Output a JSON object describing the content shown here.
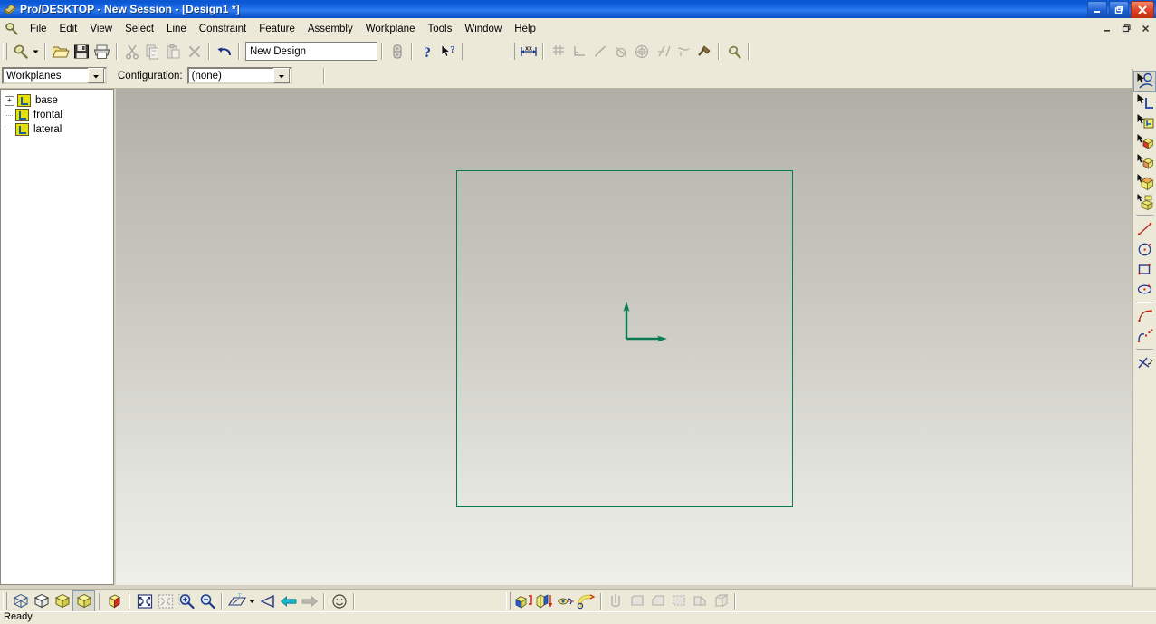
{
  "window": {
    "title": "Pro/DESKTOP - New Session - [Design1 *]",
    "app_icon": "pro-desktop-icon",
    "minimize_label": "–",
    "maximize_label": "❐",
    "close_label": "✕",
    "mdi_minimize_label": "–",
    "mdi_restore_label": "❐",
    "mdi_close_label": "✕"
  },
  "menubar": {
    "system_icon": "document-icon",
    "items": [
      {
        "label": "File"
      },
      {
        "label": "Edit"
      },
      {
        "label": "View"
      },
      {
        "label": "Select"
      },
      {
        "label": "Line"
      },
      {
        "label": "Constraint"
      },
      {
        "label": "Feature"
      },
      {
        "label": "Assembly"
      },
      {
        "label": "Workplane"
      },
      {
        "label": "Tools"
      },
      {
        "label": "Window"
      },
      {
        "label": "Help"
      }
    ]
  },
  "toolbar_main": {
    "design_name_value": "New Design",
    "buttons": [
      {
        "name": "select-tool-button",
        "icon": "magnifier-lasso-icon",
        "enabled": true
      },
      {
        "name": "select-tool-dropdown",
        "icon": "chevron-down-icon",
        "enabled": true
      },
      {
        "name": "open-button",
        "icon": "open-folder-icon",
        "enabled": true
      },
      {
        "name": "save-button",
        "icon": "floppy-save-icon",
        "enabled": true
      },
      {
        "name": "print-button",
        "icon": "printer-icon",
        "enabled": true
      },
      {
        "name": "cut-button",
        "icon": "scissors-icon",
        "enabled": false
      },
      {
        "name": "copy-button",
        "icon": "copy-icon",
        "enabled": false
      },
      {
        "name": "paste-button",
        "icon": "clipboard-paste-icon",
        "enabled": false
      },
      {
        "name": "delete-button",
        "icon": "x-delete-icon",
        "enabled": false
      },
      {
        "name": "undo-button",
        "icon": "undo-arrow-icon",
        "enabled": true
      },
      {
        "name": "browser-button",
        "icon": "browser-icon",
        "enabled": true
      },
      {
        "name": "help-button",
        "icon": "question-mark-icon",
        "enabled": true
      },
      {
        "name": "context-help-button",
        "icon": "arrow-question-icon",
        "enabled": true
      },
      {
        "name": "dimension-button",
        "icon": "dimension-xx-icon",
        "enabled": true
      },
      {
        "name": "constraint-coincident-button",
        "icon": "coincident-icon",
        "enabled": false
      },
      {
        "name": "constraint-perpendicular-button",
        "icon": "perpendicular-icon",
        "enabled": false
      },
      {
        "name": "constraint-parallel-button",
        "icon": "parallel-line-icon",
        "enabled": false
      },
      {
        "name": "constraint-tangent-button",
        "icon": "tangent-icon",
        "enabled": false
      },
      {
        "name": "constraint-concentric-button",
        "icon": "concentric-circle-icon",
        "enabled": false
      },
      {
        "name": "constraint-equal-button",
        "icon": "equal-length-icon",
        "enabled": false
      },
      {
        "name": "constraint-symmetry-button",
        "icon": "symmetry-icon",
        "enabled": false
      },
      {
        "name": "constraint-fix-button",
        "icon": "anchor-fix-icon",
        "enabled": false
      },
      {
        "name": "inspect-button",
        "icon": "magnifier-icon",
        "enabled": true
      }
    ]
  },
  "toolbar_secondary": {
    "workplanes_select_value": "Workplanes",
    "configuration_label": "Configuration:",
    "configuration_select_value": "(none)"
  },
  "tree": {
    "items": [
      {
        "label": "base",
        "icon": "workplane-icon",
        "expander": "+",
        "has_expander": true
      },
      {
        "label": "frontal",
        "icon": "workplane-icon",
        "expander": "",
        "has_expander": false
      },
      {
        "label": "lateral",
        "icon": "workplane-icon",
        "expander": "",
        "has_expander": false
      }
    ]
  },
  "canvas": {
    "name": "design-viewport",
    "workplane_outline_color": "#0a7a52",
    "origin_axes_color": "#0a7a52",
    "background_top_color": "#aeaea4",
    "background_bottom_color": "#efefe9"
  },
  "toolbar_right": {
    "buttons": [
      {
        "name": "select-edges-button",
        "icon": "select-lasso-icon"
      },
      {
        "name": "select-lines-button",
        "icon": "select-corner-icon"
      },
      {
        "name": "select-workplane-button",
        "icon": "select-workplane-icon"
      },
      {
        "name": "select-face-button",
        "icon": "select-face-cube-icon"
      },
      {
        "name": "select-feature-button",
        "icon": "select-feature-cube-icon"
      },
      {
        "name": "select-part-button",
        "icon": "select-part-cube-icon"
      },
      {
        "name": "select-assembly-button",
        "icon": "select-assembly-cube-icon"
      },
      {
        "name": "draw-line-button",
        "icon": "line-tool-icon"
      },
      {
        "name": "draw-circle-button",
        "icon": "circle-tool-icon"
      },
      {
        "name": "draw-rectangle-button",
        "icon": "rectangle-tool-icon"
      },
      {
        "name": "draw-ellipse-button",
        "icon": "ellipse-tool-icon"
      },
      {
        "name": "draw-arc-button",
        "icon": "arc-tool-icon"
      },
      {
        "name": "draw-spline-button",
        "icon": "spline-tool-icon"
      },
      {
        "name": "trim-button",
        "icon": "trim-tool-icon"
      }
    ]
  },
  "toolbar_bottom": {
    "buttons": [
      {
        "name": "view-wireframe-button",
        "icon": "wireframe-cube-icon",
        "active": false
      },
      {
        "name": "view-hidden-line-button",
        "icon": "hidden-line-cube-icon",
        "active": false
      },
      {
        "name": "view-shaded-flat-button",
        "icon": "shaded-yellow-cube-icon",
        "active": false
      },
      {
        "name": "view-shaded-button",
        "icon": "shaded-cube-icon",
        "active": true
      },
      {
        "name": "view-rendered-button",
        "icon": "rendered-red-cube-icon",
        "active": false
      },
      {
        "name": "zoom-fit-button",
        "icon": "zoom-fit-icon",
        "enabled": true
      },
      {
        "name": "zoom-selection-button",
        "icon": "zoom-selection-icon",
        "enabled": false
      },
      {
        "name": "zoom-in-button",
        "icon": "zoom-in-icon",
        "enabled": true
      },
      {
        "name": "zoom-out-button",
        "icon": "zoom-out-icon",
        "enabled": true
      },
      {
        "name": "view-workplane-button",
        "icon": "workplane-view-icon",
        "enabled": true
      },
      {
        "name": "view-workplane-dropdown",
        "icon": "chevron-down-icon",
        "enabled": true
      },
      {
        "name": "view-camera-button",
        "icon": "camera-view-icon",
        "enabled": true
      },
      {
        "name": "view-previous-button",
        "icon": "left-arrow-icon",
        "enabled": true
      },
      {
        "name": "view-next-button",
        "icon": "right-arrow-icon",
        "enabled": false
      },
      {
        "name": "view-shading-button",
        "icon": "smiley-face-icon",
        "enabled": true
      },
      {
        "name": "extrude-button",
        "icon": "extrude-icon",
        "enabled": true
      },
      {
        "name": "project-button",
        "icon": "project-profile-icon",
        "enabled": true
      },
      {
        "name": "revolve-button",
        "icon": "revolve-icon",
        "enabled": true
      },
      {
        "name": "sweep-button",
        "icon": "sweep-pipe-icon",
        "enabled": true
      },
      {
        "name": "shell-button",
        "icon": "shell-icon",
        "enabled": false
      },
      {
        "name": "round-button",
        "icon": "round-edge-icon",
        "enabled": false
      },
      {
        "name": "chamfer-button",
        "icon": "chamfer-icon",
        "enabled": false
      },
      {
        "name": "draft-button",
        "icon": "draft-icon",
        "enabled": false
      },
      {
        "name": "split-button",
        "icon": "split-icon",
        "enabled": false
      },
      {
        "name": "material-button",
        "icon": "material-icon",
        "enabled": false
      }
    ]
  },
  "statusbar": {
    "message": "Ready"
  }
}
